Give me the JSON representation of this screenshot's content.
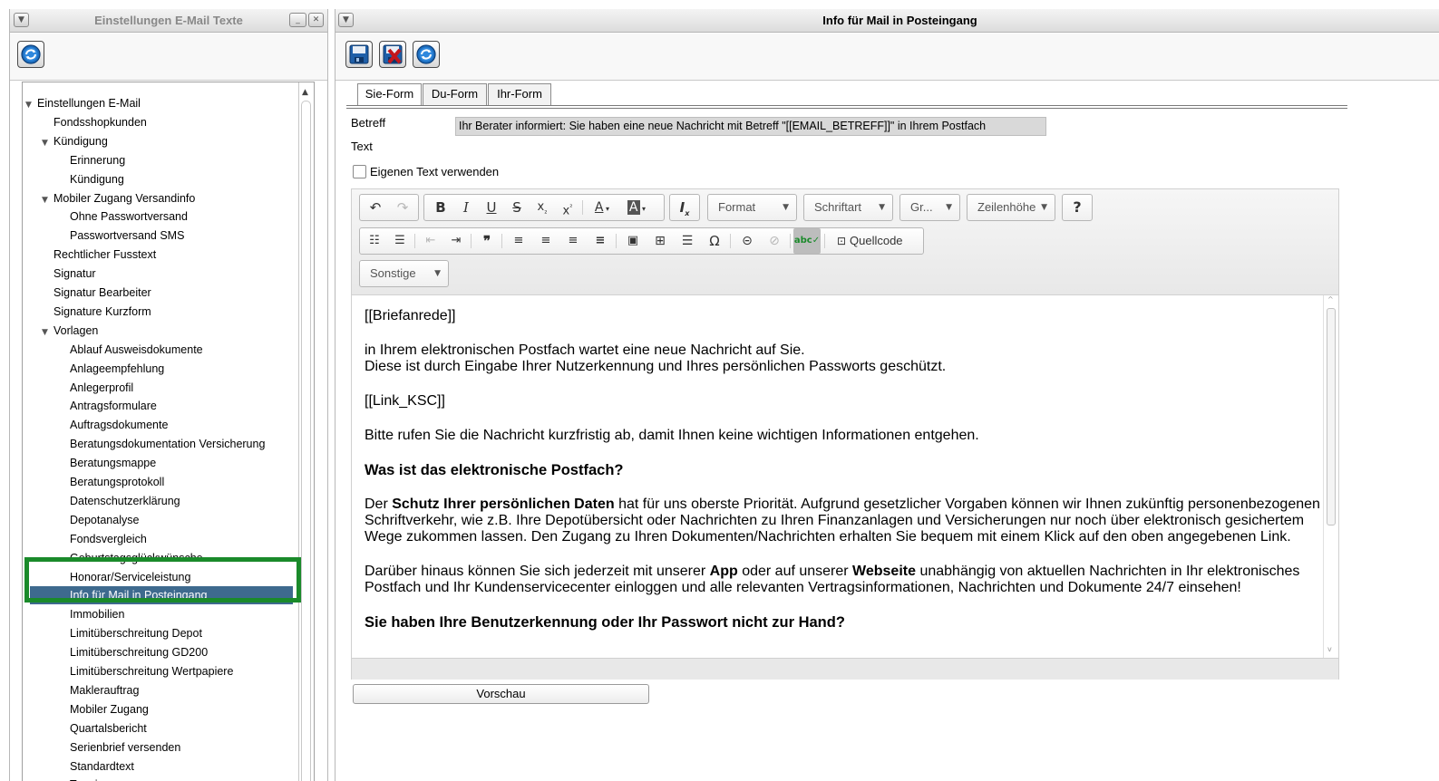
{
  "left_panel": {
    "title": "Einstellungen E-Mail Texte",
    "refresh_icon": "refresh-icon",
    "tree": [
      {
        "label": "Einstellungen E-Mail",
        "level": 0,
        "expanded": true
      },
      {
        "label": "Fondsshopkunden",
        "level": 1
      },
      {
        "label": "Kündigung",
        "level": 1,
        "expanded": true
      },
      {
        "label": "Erinnerung",
        "level": 2
      },
      {
        "label": "Kündigung",
        "level": 2
      },
      {
        "label": "Mobiler Zugang Versandinfo",
        "level": 1,
        "expanded": true
      },
      {
        "label": "Ohne Passwortversand",
        "level": 2
      },
      {
        "label": "Passwortversand SMS",
        "level": 2
      },
      {
        "label": "Rechtlicher Fusstext",
        "level": 1
      },
      {
        "label": "Signatur",
        "level": 1
      },
      {
        "label": "Signatur Bearbeiter",
        "level": 1
      },
      {
        "label": "Signature Kurzform",
        "level": 1
      },
      {
        "label": "Vorlagen",
        "level": 1,
        "expanded": true
      },
      {
        "label": "Ablauf Ausweisdokumente",
        "level": 2
      },
      {
        "label": "Anlageempfehlung",
        "level": 2
      },
      {
        "label": "Anlegerprofil",
        "level": 2
      },
      {
        "label": "Antragsformulare",
        "level": 2
      },
      {
        "label": "Auftragsdokumente",
        "level": 2
      },
      {
        "label": "Beratungsdokumentation Versicherung",
        "level": 2
      },
      {
        "label": "Beratungsmappe",
        "level": 2
      },
      {
        "label": "Beratungsprotokoll",
        "level": 2
      },
      {
        "label": "Datenschutzerklärung",
        "level": 2
      },
      {
        "label": "Depotanalyse",
        "level": 2
      },
      {
        "label": "Fondsvergleich",
        "level": 2
      },
      {
        "label": "Geburtstagsglückwünsche",
        "level": 2
      },
      {
        "label": "Honorar/Serviceleistung",
        "level": 2
      },
      {
        "label": "Info für Mail in Posteingang",
        "level": 2,
        "selected": true
      },
      {
        "label": "Immobilien",
        "level": 2
      },
      {
        "label": "Limitüberschreitung Depot",
        "level": 2
      },
      {
        "label": "Limitüberschreitung GD200",
        "level": 2
      },
      {
        "label": "Limitüberschreitung Wertpapiere",
        "level": 2
      },
      {
        "label": "Maklerauftrag",
        "level": 2
      },
      {
        "label": "Mobiler Zugang",
        "level": 2
      },
      {
        "label": "Quartalsbericht",
        "level": 2
      },
      {
        "label": "Serienbrief versenden",
        "level": 2
      },
      {
        "label": "Standardtext",
        "level": 2
      },
      {
        "label": "Terminwarnung",
        "level": 2
      }
    ]
  },
  "right_panel": {
    "title": "Info für Mail in Posteingang",
    "tabs": [
      "Sie-Form",
      "Du-Form",
      "Ihr-Form"
    ],
    "active_tab": "Sie-Form",
    "betreff_label": "Betreff",
    "betreff_value": "Ihr Berater informiert: Sie haben eine neue Nachricht mit Betreff \"[[EMAIL_BETREFF]]\" in Ihrem Postfach",
    "text_label": "Text",
    "own_text_label": "Eigenen Text verwenden",
    "own_text_checked": false,
    "toolbar": {
      "format": "Format",
      "font": "Schriftart",
      "size": "Gr...",
      "line_height": "Zeilenhöhe",
      "help": "?",
      "source": "Quellcode",
      "other": "Sonstige"
    },
    "content": {
      "p1": "[[Briefanrede]]",
      "p2a": "in Ihrem elektronischen Postfach wartet eine neue Nachricht auf Sie.",
      "p2b": "Diese ist durch Eingabe Ihrer Nutzerkennung und Ihres persönlichen Passworts geschützt.",
      "p3": "[[Link_KSC]]",
      "p4": "Bitte rufen Sie die Nachricht kurzfristig ab, damit Ihnen keine wichtigen Informationen entgehen.",
      "h1": "Was ist das elektronische Postfach?",
      "p5_pre": "Der ",
      "p5_bold": "Schutz Ihrer persönlichen Daten",
      "p5_post": " hat für uns oberste Priorität. Aufgrund gesetzlicher Vorgaben können wir Ihnen zukünftig personenbezogenen Schriftverkehr, wie z.B. Ihre Depotübersicht oder Nachrichten zu Ihren Finanzanlagen und Versicherungen nur noch über elektronisch gesichertem Wege zukommen lassen. Den Zugang zu Ihren Dokumenten/Nachrichten erhalten Sie bequem mit einem Klick auf den oben angegebenen Link.",
      "p6_pre": "Darüber hinaus können Sie sich jederzeit mit unserer ",
      "p6_bold1": "App",
      "p6_mid": " oder auf unserer ",
      "p6_bold2": "Webseite",
      "p6_post": " unabhängig von aktuellen Nachrichten in Ihr elektronisches Postfach und Ihr Kundenservicecenter einloggen und alle relevanten Vertragsinformationen, Nachrichten und Dokumente 24/7 einsehen!",
      "h2": "Sie haben Ihre Benutzerkennung oder Ihr Passwort nicht zur Hand?"
    },
    "preview_button": "Vorschau"
  },
  "colors": {
    "selection_bg": "#3e6a8e",
    "highlight_frame": "#1a8a2a",
    "save_icon": "#1f5fa8",
    "discard_icon": "#c4161c"
  }
}
